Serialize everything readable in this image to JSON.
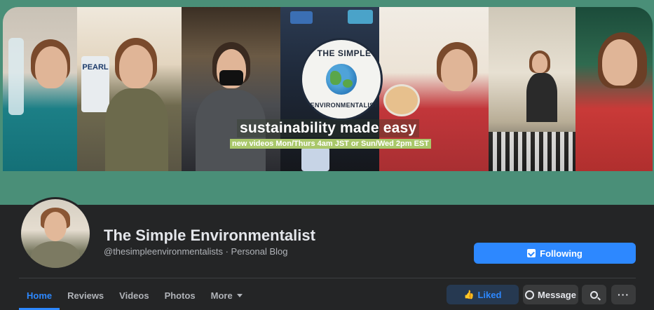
{
  "cover": {
    "badge_top": "THE SIMPLE",
    "badge_bottom": "ENVIRONMENTALIST",
    "tagline": "sustainability made easy",
    "subline": "new videos Mon/Thurs 4am JST or Sun/Wed 2pm EST",
    "bottle_label": "PEARL",
    "accent_color": "#4a8f78"
  },
  "profile": {
    "name": "The Simple Environmentalist",
    "handle": "@thesimpleenvironmentalists · Personal Blog"
  },
  "actions": {
    "following_label": "Following",
    "liked_label": "Liked",
    "message_label": "Message",
    "search_icon": "search-icon",
    "more_label": "···"
  },
  "tabs": [
    {
      "label": "Home",
      "active": true
    },
    {
      "label": "Reviews"
    },
    {
      "label": "Videos"
    },
    {
      "label": "Photos"
    },
    {
      "label": "More"
    }
  ],
  "colors": {
    "background": "#242526",
    "primary": "#2d88ff",
    "button_secondary": "#3a3b3c"
  }
}
